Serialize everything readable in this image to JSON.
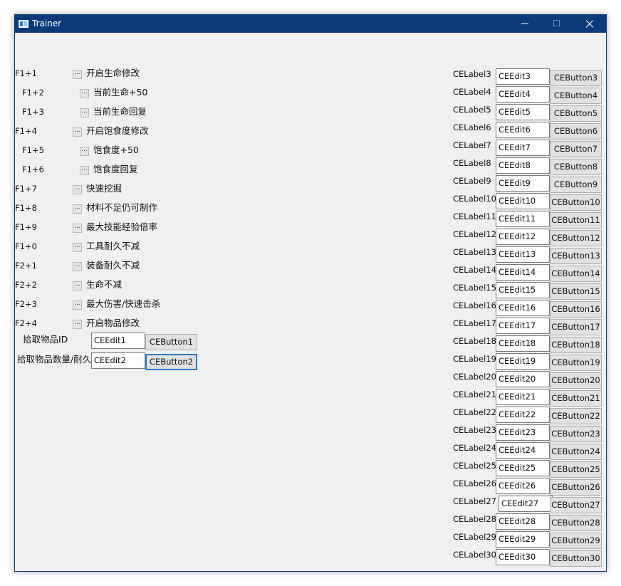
{
  "window": {
    "title": "Trainer",
    "colors": {
      "titlebar": "#0b3a79",
      "client": "#f0f0f0",
      "focus": "#2a79c9"
    }
  },
  "features": [
    {
      "hotkey": "F1+1",
      "checkbox_text": "...",
      "label": "开启生命修改"
    },
    {
      "hotkey": "F1+2",
      "checkbox_text": "...",
      "label": "当前生命+50"
    },
    {
      "hotkey": "F1+3",
      "checkbox_text": "...",
      "label": "当前生命回复"
    },
    {
      "hotkey": "F1+4",
      "checkbox_text": "...",
      "label": "开启饱食度修改"
    },
    {
      "hotkey": "F1+5",
      "checkbox_text": "...",
      "label": "饱食度+50"
    },
    {
      "hotkey": "F1+6",
      "checkbox_text": "...",
      "label": "饱食度回复"
    },
    {
      "hotkey": "F1+7",
      "checkbox_text": "...",
      "label": "快速挖掘"
    },
    {
      "hotkey": "F1+8",
      "checkbox_text": "...",
      "label": "材料不足仍可制作"
    },
    {
      "hotkey": "F1+9",
      "checkbox_text": "...",
      "label": "最大技能经验倍率"
    },
    {
      "hotkey": "F1+0",
      "checkbox_text": "...",
      "label": "工具耐久不减"
    },
    {
      "hotkey": "F2+1",
      "checkbox_text": "...",
      "label": "装备耐久不减"
    },
    {
      "hotkey": "F2+2",
      "checkbox_text": "...",
      "label": "生命不减"
    },
    {
      "hotkey": "F2+3",
      "checkbox_text": "...",
      "label": "最大伤害/快速击杀"
    },
    {
      "hotkey": "F2+4",
      "checkbox_text": "...",
      "label": "开启物品修改"
    }
  ],
  "item_controls": [
    {
      "label": "拾取物品ID",
      "edit_value": "CEEdit1",
      "button_label": "CEButton1"
    },
    {
      "label": "拾取物品数量/耐久",
      "edit_value": "CEEdit2",
      "button_label": "CEButton2"
    }
  ],
  "right_rows": [
    {
      "label": "CELabel3",
      "edit_value": "CEEdit3",
      "button_label": "CEButton3"
    },
    {
      "label": "CELabel4",
      "edit_value": "CEEdit4",
      "button_label": "CEButton4"
    },
    {
      "label": "CELabel5",
      "edit_value": "CEEdit5",
      "button_label": "CEButton5"
    },
    {
      "label": "CELabel6",
      "edit_value": "CEEdit6",
      "button_label": "CEButton6"
    },
    {
      "label": "CELabel7",
      "edit_value": "CEEdit7",
      "button_label": "CEButton7"
    },
    {
      "label": "CELabel8",
      "edit_value": "CEEdit8",
      "button_label": "CEButton8"
    },
    {
      "label": "CELabel9",
      "edit_value": "CEEdit9",
      "button_label": "CEButton9"
    },
    {
      "label": "CELabel10",
      "edit_value": "CEEdit10",
      "button_label": "CEButton10"
    },
    {
      "label": "CELabel11",
      "edit_value": "CEEdit11",
      "button_label": "CEButton11"
    },
    {
      "label": "CELabel12",
      "edit_value": "CEEdit12",
      "button_label": "CEButton12"
    },
    {
      "label": "CELabel13",
      "edit_value": "CEEdit13",
      "button_label": "CEButton13"
    },
    {
      "label": "CELabel14",
      "edit_value": "CEEdit14",
      "button_label": "CEButton14"
    },
    {
      "label": "CELabel15",
      "edit_value": "CEEdit15",
      "button_label": "CEButton15"
    },
    {
      "label": "CELabel16",
      "edit_value": "CEEdit16",
      "button_label": "CEButton16"
    },
    {
      "label": "CELabel17",
      "edit_value": "CEEdit17",
      "button_label": "CEButton17"
    },
    {
      "label": "CELabel18",
      "edit_value": "CEEdit18",
      "button_label": "CEButton18"
    },
    {
      "label": "CELabel19",
      "edit_value": "CEEdit19",
      "button_label": "CEButton19"
    },
    {
      "label": "CELabel20",
      "edit_value": "CEEdit20",
      "button_label": "CEButton20"
    },
    {
      "label": "CELabel21",
      "edit_value": "CEEdit21",
      "button_label": "CEButton21"
    },
    {
      "label": "CELabel22",
      "edit_value": "CEEdit22",
      "button_label": "CEButton22"
    },
    {
      "label": "CELabel23",
      "edit_value": "CEEdit23",
      "button_label": "CEButton23"
    },
    {
      "label": "CELabel24",
      "edit_value": "CEEdit24",
      "button_label": "CEButton24"
    },
    {
      "label": "CELabel25",
      "edit_value": "CEEdit25",
      "button_label": "CEButton25"
    },
    {
      "label": "CELabel26",
      "edit_value": "CEEdit26",
      "button_label": "CEButton26"
    },
    {
      "label": "CELabel27",
      "edit_value": "CEEdit27",
      "button_label": "CEButton27"
    },
    {
      "label": "CELabel28",
      "edit_value": "CEEdit28",
      "button_label": "CEButton28"
    },
    {
      "label": "CELabel29",
      "edit_value": "CEEdit29",
      "button_label": "CEButton29"
    },
    {
      "label": "CELabel30",
      "edit_value": "CEEdit30",
      "button_label": "CEButton30"
    }
  ]
}
